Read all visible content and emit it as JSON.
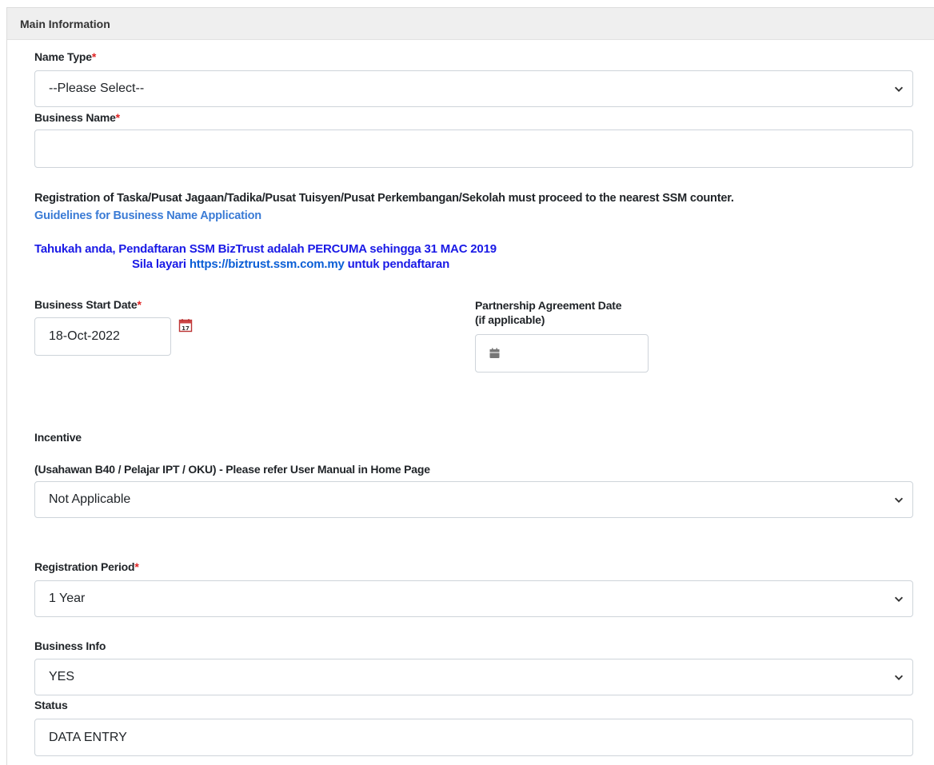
{
  "panel": {
    "title": "Main Information"
  },
  "name_type": {
    "label": "Name Type",
    "required_mark": "*",
    "value": "--Please Select--"
  },
  "business_name": {
    "label": "Business Name",
    "required_mark": "*",
    "value": ""
  },
  "notice": {
    "registration_text": "Registration of Taska/Pusat Jagaan/Tadika/Pusat Tuisyen/Pusat Perkembangan/Sekolah must proceed to the nearest SSM counter.",
    "guidelines_link": "Guidelines for Business Name Application",
    "biztrust_line1_a": "Tahukah anda, Pendaftaran SSM BizTrust adalah ",
    "biztrust_line1_b": "PERCUMA",
    "biztrust_line1_c": " sehingga 31 MAC 2019",
    "biztrust_line2_a": "Sila layari ",
    "biztrust_line2_url": "https://biztrust.ssm.com.my",
    "biztrust_line2_b": " untuk pendaftaran"
  },
  "business_start_date": {
    "label": "Business Start Date",
    "required_mark": "*",
    "value": "18-Oct-2022"
  },
  "partnership_date": {
    "label_line1": "Partnership Agreement Date",
    "label_line2": "(if applicable)",
    "value": ""
  },
  "incentive": {
    "label": "Incentive",
    "sublabel": "(Usahawan B40 / Pelajar IPT / OKU) - Please refer User Manual in Home Page",
    "value": "Not Applicable"
  },
  "registration_period": {
    "label": "Registration Period",
    "required_mark": "*",
    "value": "1 Year"
  },
  "business_info": {
    "label": "Business Info",
    "value": "YES"
  },
  "status": {
    "label": "Status",
    "value": "DATA ENTRY"
  },
  "colors": {
    "required": "#e02424",
    "link": "#3a7bd5",
    "notice_blue": "#1a1ae6"
  }
}
